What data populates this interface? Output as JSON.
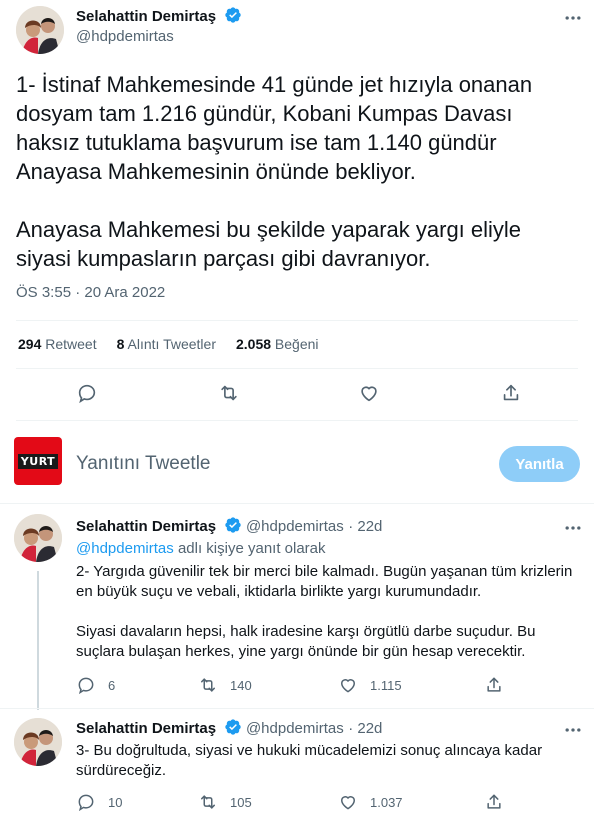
{
  "main_tweet": {
    "author_name": "Selahattin Demirtaş",
    "author_handle": "@hdpdemirtas",
    "paragraph1": "1- İstinaf Mahkemesinde 41 günde jet hızıyla onanan dosyam tam 1.216 gündür, Kobani Kumpas Davası haksız tutuklama başvurum ise tam 1.140 gündür Anayasa Mahkemesinin önünde bekliyor.",
    "paragraph2": "Anayasa Mahkemesi bu şekilde yaparak yargı eliyle siyasi kumpasların parçası gibi davranıyor.",
    "timestamp": "ÖS 3:55 · 20 Ara 2022",
    "retweets": "294",
    "retweets_label": "Retweet",
    "quotes": "8",
    "quotes_label": "Alıntı Tweetler",
    "likes": "2.058",
    "likes_label": "Beğeni"
  },
  "compose": {
    "avatar_text": "YURT",
    "placeholder": "Yanıtını Tweetle",
    "button_label": "Yanıtla"
  },
  "replies": [
    {
      "author_name": "Selahattin Demirtaş",
      "author_handle": "@hdpdemirtas",
      "time": "· 22d",
      "replying_to_handle": "@hdpdemirtas",
      "replying_to_suffix": " adlı kişiye yanıt olarak",
      "text1": "2- Yargıda güvenilir tek bir merci bile kalmadı. Bugün yaşanan tüm krizlerin en büyük suçu ve vebali, iktidarla birlikte yargı kurumundadır.",
      "text2": "Siyasi davaların hepsi, halk iradesine karşı örgütlü darbe suçudur. Bu suçlara bulaşan herkes, yine yargı önünde bir gün hesap verecektir.",
      "replies": "6",
      "retweets": "140",
      "likes": "1.115"
    },
    {
      "author_name": "Selahattin Demirtaş",
      "author_handle": "@hdpdemirtas",
      "time": "· 22d",
      "text1": "3- Bu doğrultuda, siyasi ve hukuki mücadelemizi sonuç alıncaya kadar sürdüreceğiz.",
      "replies": "10",
      "retweets": "105",
      "likes": "1.037"
    }
  ],
  "icons": {
    "verified": "verified-badge-icon",
    "more": "more-icon",
    "reply": "reply-icon",
    "retweet": "retweet-icon",
    "like": "like-icon",
    "share": "share-icon"
  },
  "colors": {
    "accent": "#1d9bf0",
    "text": "#0f1419",
    "muted": "#536471",
    "reply_button_disabled": "#8ecdf8",
    "yurt_red": "#e30a17"
  }
}
